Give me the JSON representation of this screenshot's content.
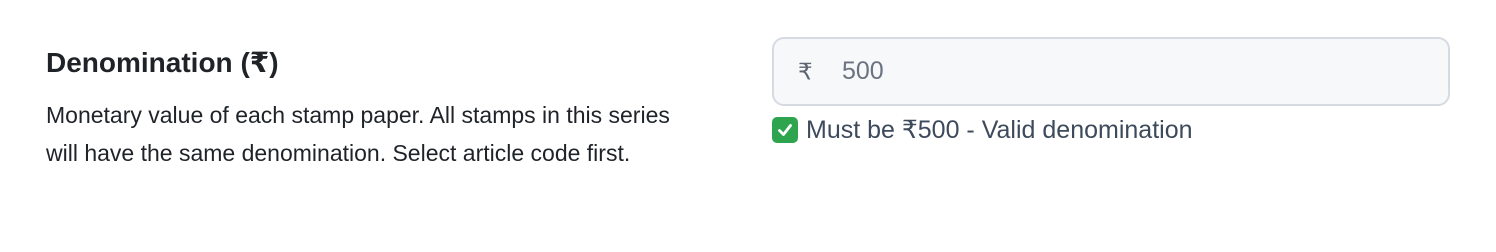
{
  "field": {
    "title": "Denomination (₹)",
    "description": "Monetary value of each stamp paper. All stamps in this series will have the same denomination. Select article code first.",
    "currency_symbol": "₹",
    "value": "500",
    "validation": {
      "icon": "check-icon",
      "status": "valid",
      "color": "#2ea44f",
      "message": "Must be ₹500 - Valid denomination"
    }
  }
}
